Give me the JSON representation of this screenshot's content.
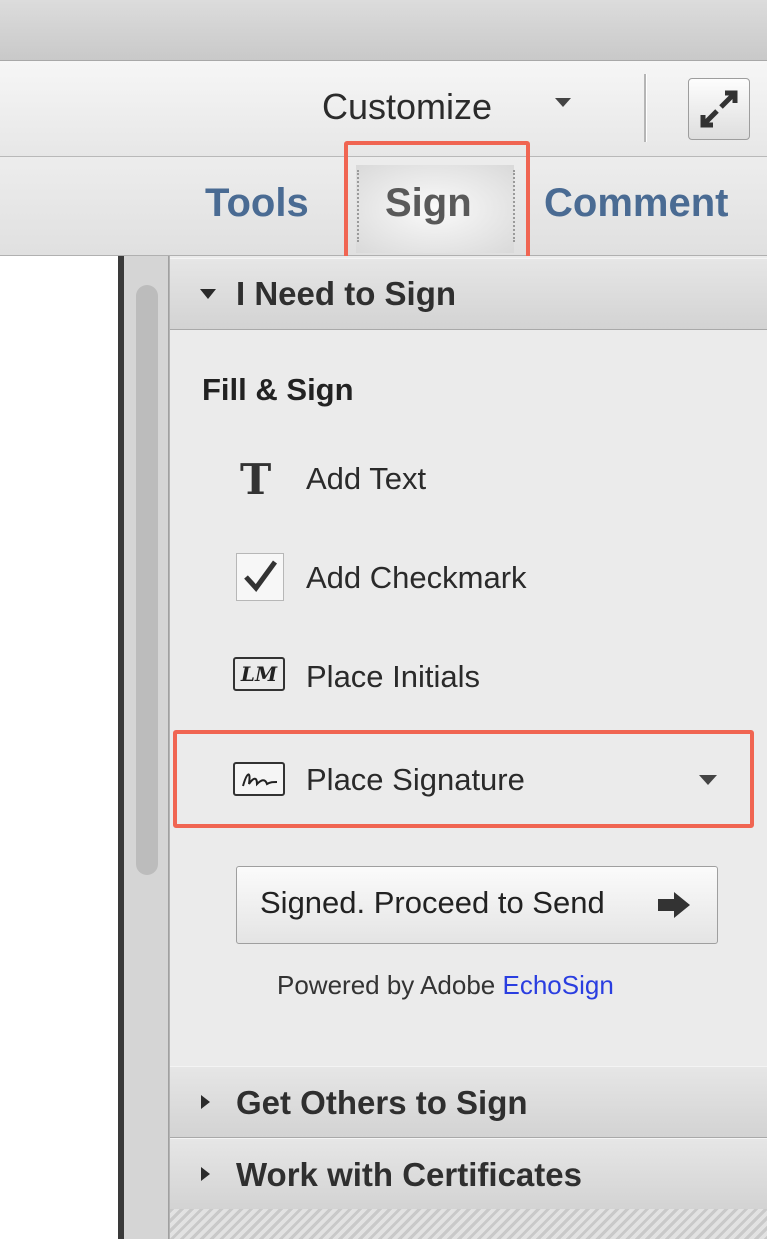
{
  "toolbar": {
    "customize_label": "Customize"
  },
  "tabs": [
    {
      "label": "Tools"
    },
    {
      "label": "Sign"
    },
    {
      "label": "Comment"
    }
  ],
  "panel": {
    "sections": [
      {
        "title": "I Need to Sign",
        "expanded": true
      },
      {
        "title": "Get Others to Sign",
        "expanded": false
      },
      {
        "title": "Work with Certificates",
        "expanded": false
      }
    ],
    "fill_sign": {
      "heading": "Fill & Sign",
      "items": [
        {
          "label": "Add Text",
          "icon": "text-T-icon"
        },
        {
          "label": "Add Checkmark",
          "icon": "checkmark-icon"
        },
        {
          "label": "Place Initials",
          "icon": "initials-icon",
          "icon_text": "LM"
        },
        {
          "label": "Place Signature",
          "icon": "signature-icon"
        }
      ],
      "proceed_button": "Signed. Proceed to Send",
      "powered_prefix": "Powered by Adobe ",
      "powered_link": "EchoSign"
    }
  },
  "colors": {
    "highlight": "#f06552",
    "tab_text": "#4a6b93",
    "link": "#2a3ee0"
  }
}
